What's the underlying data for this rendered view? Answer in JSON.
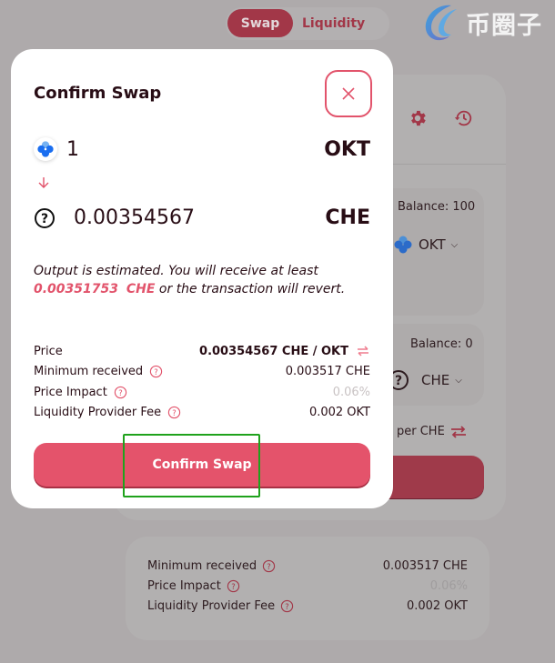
{
  "nav": {
    "tabs": [
      {
        "label": "Swap",
        "active": true
      },
      {
        "label": "Liquidity",
        "active": false
      }
    ],
    "brand_text": "币圈子"
  },
  "background_card": {
    "icons": [
      "gear-icon",
      "history-icon"
    ],
    "from_input": {
      "balance": "Balance: 100",
      "token": "OKT"
    },
    "to_input": {
      "balance": "Balance: 0",
      "token": "CHE"
    },
    "rate_text": "per  CHE",
    "details": [
      {
        "label": "Minimum received",
        "value": "0.003517   CHE"
      },
      {
        "label": "Price Impact",
        "value": "0.06%"
      },
      {
        "label": "Liquidity Provider Fee",
        "value": "0.002 OKT"
      }
    ]
  },
  "modal": {
    "title": "Confirm Swap",
    "close_icon": "close-icon",
    "from": {
      "amount": "1",
      "symbol": "OKT"
    },
    "to": {
      "amount": "0.00354567",
      "symbol": "CHE"
    },
    "estimate": {
      "prefix": "Output is estimated. You will receive at least ",
      "min_amount": "0.00351753",
      "min_symbol": "CHE",
      "suffix": " or the transaction will revert."
    },
    "details": {
      "price": {
        "label": "Price",
        "value": "0.00354567  CHE / OKT"
      },
      "minimum_received": {
        "label": "Minimum received",
        "value": "0.003517   CHE"
      },
      "price_impact": {
        "label": "Price Impact",
        "value": "0.06%"
      },
      "lp_fee": {
        "label": "Liquidity Provider Fee",
        "value": "0.002 OKT"
      }
    },
    "confirm_label": "Confirm Swap"
  },
  "colors": {
    "accent": "#e4536b",
    "accent_dark": "#a23748",
    "highlight": "#1fa21c"
  }
}
